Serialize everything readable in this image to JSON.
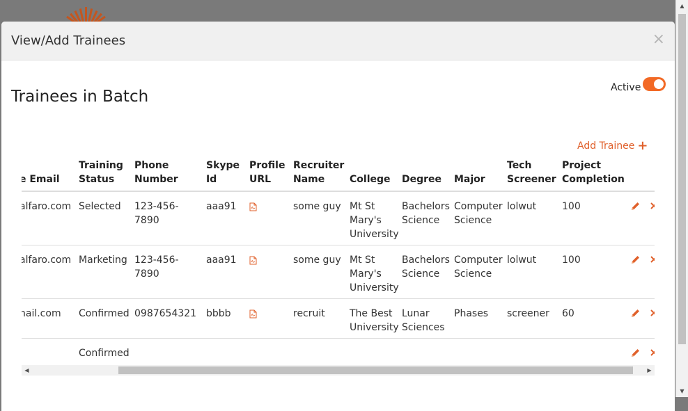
{
  "modal": {
    "title": "View/Add Trainees",
    "close_icon": "×",
    "section_title": "Trainees in Batch",
    "active_label": "Active",
    "active_on": true,
    "add_label": "Add Trainee",
    "add_icon": "+"
  },
  "table": {
    "headers": {
      "email": [
        "e Email"
      ],
      "status": [
        "Training",
        "Status"
      ],
      "phone": [
        "Phone",
        "Number"
      ],
      "skype": [
        "Skype",
        "Id"
      ],
      "profile": [
        "Profile",
        "URL"
      ],
      "recruiter": [
        "Recruiter",
        "Name"
      ],
      "college": [
        "College"
      ],
      "degree": [
        "Degree"
      ],
      "major": [
        "Major"
      ],
      "tech": [
        "Tech",
        "Screener"
      ],
      "project": [
        "Project",
        "Completion"
      ]
    },
    "rows": [
      {
        "email": "alfaro.com",
        "status": "Selected",
        "phone": [
          "123-456-",
          "7890"
        ],
        "skype": "aaa91",
        "profile": "pdf-icon",
        "recruiter": "some guy",
        "college": [
          "Mt St",
          "Mary's",
          "University"
        ],
        "degree": [
          "Bachelors",
          "Science"
        ],
        "major": [
          "Computer",
          "Science"
        ],
        "tech": "lolwut",
        "project": "100"
      },
      {
        "email": "alfaro.com",
        "status": "Marketing",
        "phone": [
          "123-456-",
          "7890"
        ],
        "skype": "aaa91",
        "profile": "pdf-icon",
        "recruiter": "some guy",
        "college": [
          "Mt St",
          "Mary's",
          "University"
        ],
        "degree": [
          "Bachelors",
          "Science"
        ],
        "major": [
          "Computer",
          "Science"
        ],
        "tech": "lolwut",
        "project": "100"
      },
      {
        "email": "nail.com",
        "status": "Confirmed",
        "phone": [
          "0987654321"
        ],
        "skype": "bbbb",
        "profile": "pdf-icon",
        "recruiter": "recruit",
        "college": [
          "The Best",
          "University"
        ],
        "degree": [
          "Lunar",
          "Sciences"
        ],
        "major": [
          "Phases"
        ],
        "tech": "screener",
        "project": "60"
      },
      {
        "email": "ı",
        "status": "Confirmed",
        "phone": [
          ""
        ],
        "skype": "",
        "profile": "",
        "recruiter": "",
        "college": [
          ""
        ],
        "degree": [
          ""
        ],
        "major": [
          ""
        ],
        "tech": "",
        "project": ""
      }
    ]
  },
  "colors": {
    "accent": "#e0602b",
    "toggle": "#f26925",
    "backdrop": "#7a7a7a"
  }
}
